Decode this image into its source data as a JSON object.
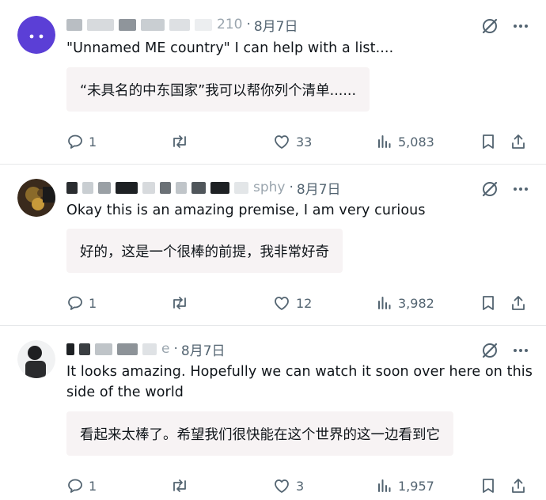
{
  "tweets": [
    {
      "handle_tail": "210",
      "date": "8月7日",
      "text": "\"Unnamed ME country\" I can help with a list....",
      "translation": "“未具名的中东国家”我可以帮你列个清单......",
      "replies": "1",
      "reposts": "",
      "likes": "33",
      "views": "5,083"
    },
    {
      "handle_tail": "sphy",
      "date": "8月7日",
      "text": "Okay this is an amazing premise, I am very curious",
      "translation": "好的，这是一个很棒的前提，我非常好奇",
      "replies": "1",
      "reposts": "",
      "likes": "12",
      "views": "3,982"
    },
    {
      "handle_tail": "e",
      "date": "8月7日",
      "text": "It looks amazing. Hopefully we can watch it soon over here on this side of the world",
      "translation": "看起来太棒了。希望我们很快能在这个世界的这一边看到它",
      "replies": "1",
      "reposts": "",
      "likes": "3",
      "views": "1,957"
    }
  ],
  "header_separator": "·",
  "colors": {
    "text": "#0f1419",
    "muted": "#536471",
    "translation_bg": "#f7f3f4",
    "avatar_purple": "#5b3fd6",
    "divider": "#e6e8ea"
  },
  "icons": [
    "grok-icon",
    "more-icon",
    "reply-icon",
    "repost-icon",
    "like-icon",
    "views-icon",
    "bookmark-icon",
    "share-icon"
  ]
}
